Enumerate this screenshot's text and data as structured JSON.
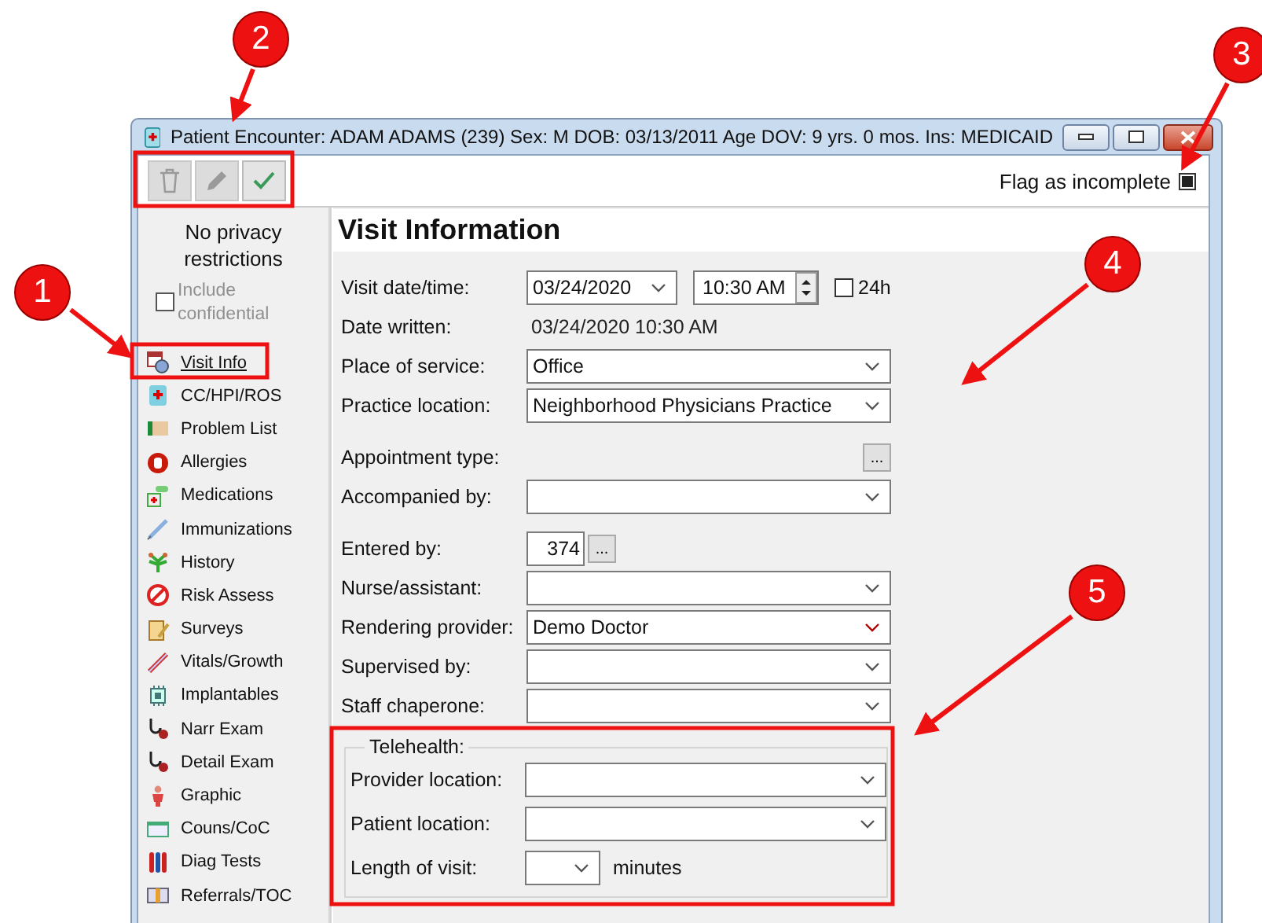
{
  "window": {
    "title": "Patient Encounter: ADAM ADAMS (239)  Sex: M  DOB: 03/13/2011  Age DOV: 9 yrs. 0 mos.  Ins: MEDICAID"
  },
  "toolbar": {
    "buttons": [
      {
        "kind": "delete",
        "disabled": true
      },
      {
        "kind": "edit",
        "disabled": true
      },
      {
        "kind": "save",
        "disabled": false
      }
    ],
    "flag": {
      "label": "Flag as incomplete",
      "checked": true
    }
  },
  "sidebar": {
    "privacy": "No privacy restrictions",
    "include_confidential": {
      "label": "Include confidential",
      "checked": false,
      "disabled": true
    },
    "items": [
      {
        "label": "Visit Info",
        "selected": true
      },
      {
        "label": "CC/HPI/ROS",
        "selected": false
      },
      {
        "label": "Problem List",
        "selected": false
      },
      {
        "label": "Allergies",
        "selected": false
      },
      {
        "label": "Medications",
        "selected": false
      },
      {
        "label": "Immunizations",
        "selected": false
      },
      {
        "label": "History",
        "selected": false
      },
      {
        "label": "Risk Assess",
        "selected": false
      },
      {
        "label": "Surveys",
        "selected": false
      },
      {
        "label": "Vitals/Growth",
        "selected": false
      },
      {
        "label": "Implantables",
        "selected": false
      },
      {
        "label": "Narr Exam",
        "selected": false
      },
      {
        "label": "Detail Exam",
        "selected": false
      },
      {
        "label": "Graphic",
        "selected": false
      },
      {
        "label": "Couns/CoC",
        "selected": false
      },
      {
        "label": "Diag Tests",
        "selected": false
      },
      {
        "label": "Referrals/TOC",
        "selected": false
      }
    ]
  },
  "main": {
    "title": "Visit Information",
    "field_groups": [
      [
        {
          "kind": "datetime",
          "label": "Visit date/time:",
          "date": "03/24/2020",
          "time": "10:30 AM",
          "option": {
            "label": "24h",
            "checked": false
          }
        },
        {
          "kind": "text",
          "label": "Date written:",
          "value": "03/24/2020 10:30 AM"
        },
        {
          "kind": "select",
          "label": "Place of service:",
          "value": "Office",
          "required": false
        },
        {
          "kind": "select",
          "label": "Practice location:",
          "value": "Neighborhood Physicians Practice",
          "required": false
        }
      ],
      [
        {
          "kind": "lookup",
          "label": "Appointment type:",
          "button": "..."
        },
        {
          "kind": "select",
          "label": "Accompanied by:",
          "required": false
        }
      ],
      [
        {
          "kind": "entry",
          "label": "Entered by:",
          "value": "374",
          "button": "..."
        },
        {
          "kind": "select",
          "label": "Nurse/assistant:",
          "required": false
        },
        {
          "kind": "select",
          "label": "Rendering provider:",
          "value": "Demo Doctor",
          "required": true
        },
        {
          "kind": "select",
          "label": "Supervised by:",
          "required": false
        },
        {
          "kind": "select",
          "label": "Staff chaperone:",
          "required": false
        }
      ]
    ],
    "telehealth": {
      "title": "Telehealth:",
      "fields": [
        {
          "kind": "select",
          "label": "Provider location:"
        },
        {
          "kind": "select",
          "label": "Patient location:"
        },
        {
          "kind": "duration",
          "label": "Length of visit:",
          "unit": "minutes"
        }
      ]
    }
  },
  "annotations": [
    {
      "number": "1"
    },
    {
      "number": "2"
    },
    {
      "number": "3"
    },
    {
      "number": "4"
    },
    {
      "number": "5"
    }
  ]
}
